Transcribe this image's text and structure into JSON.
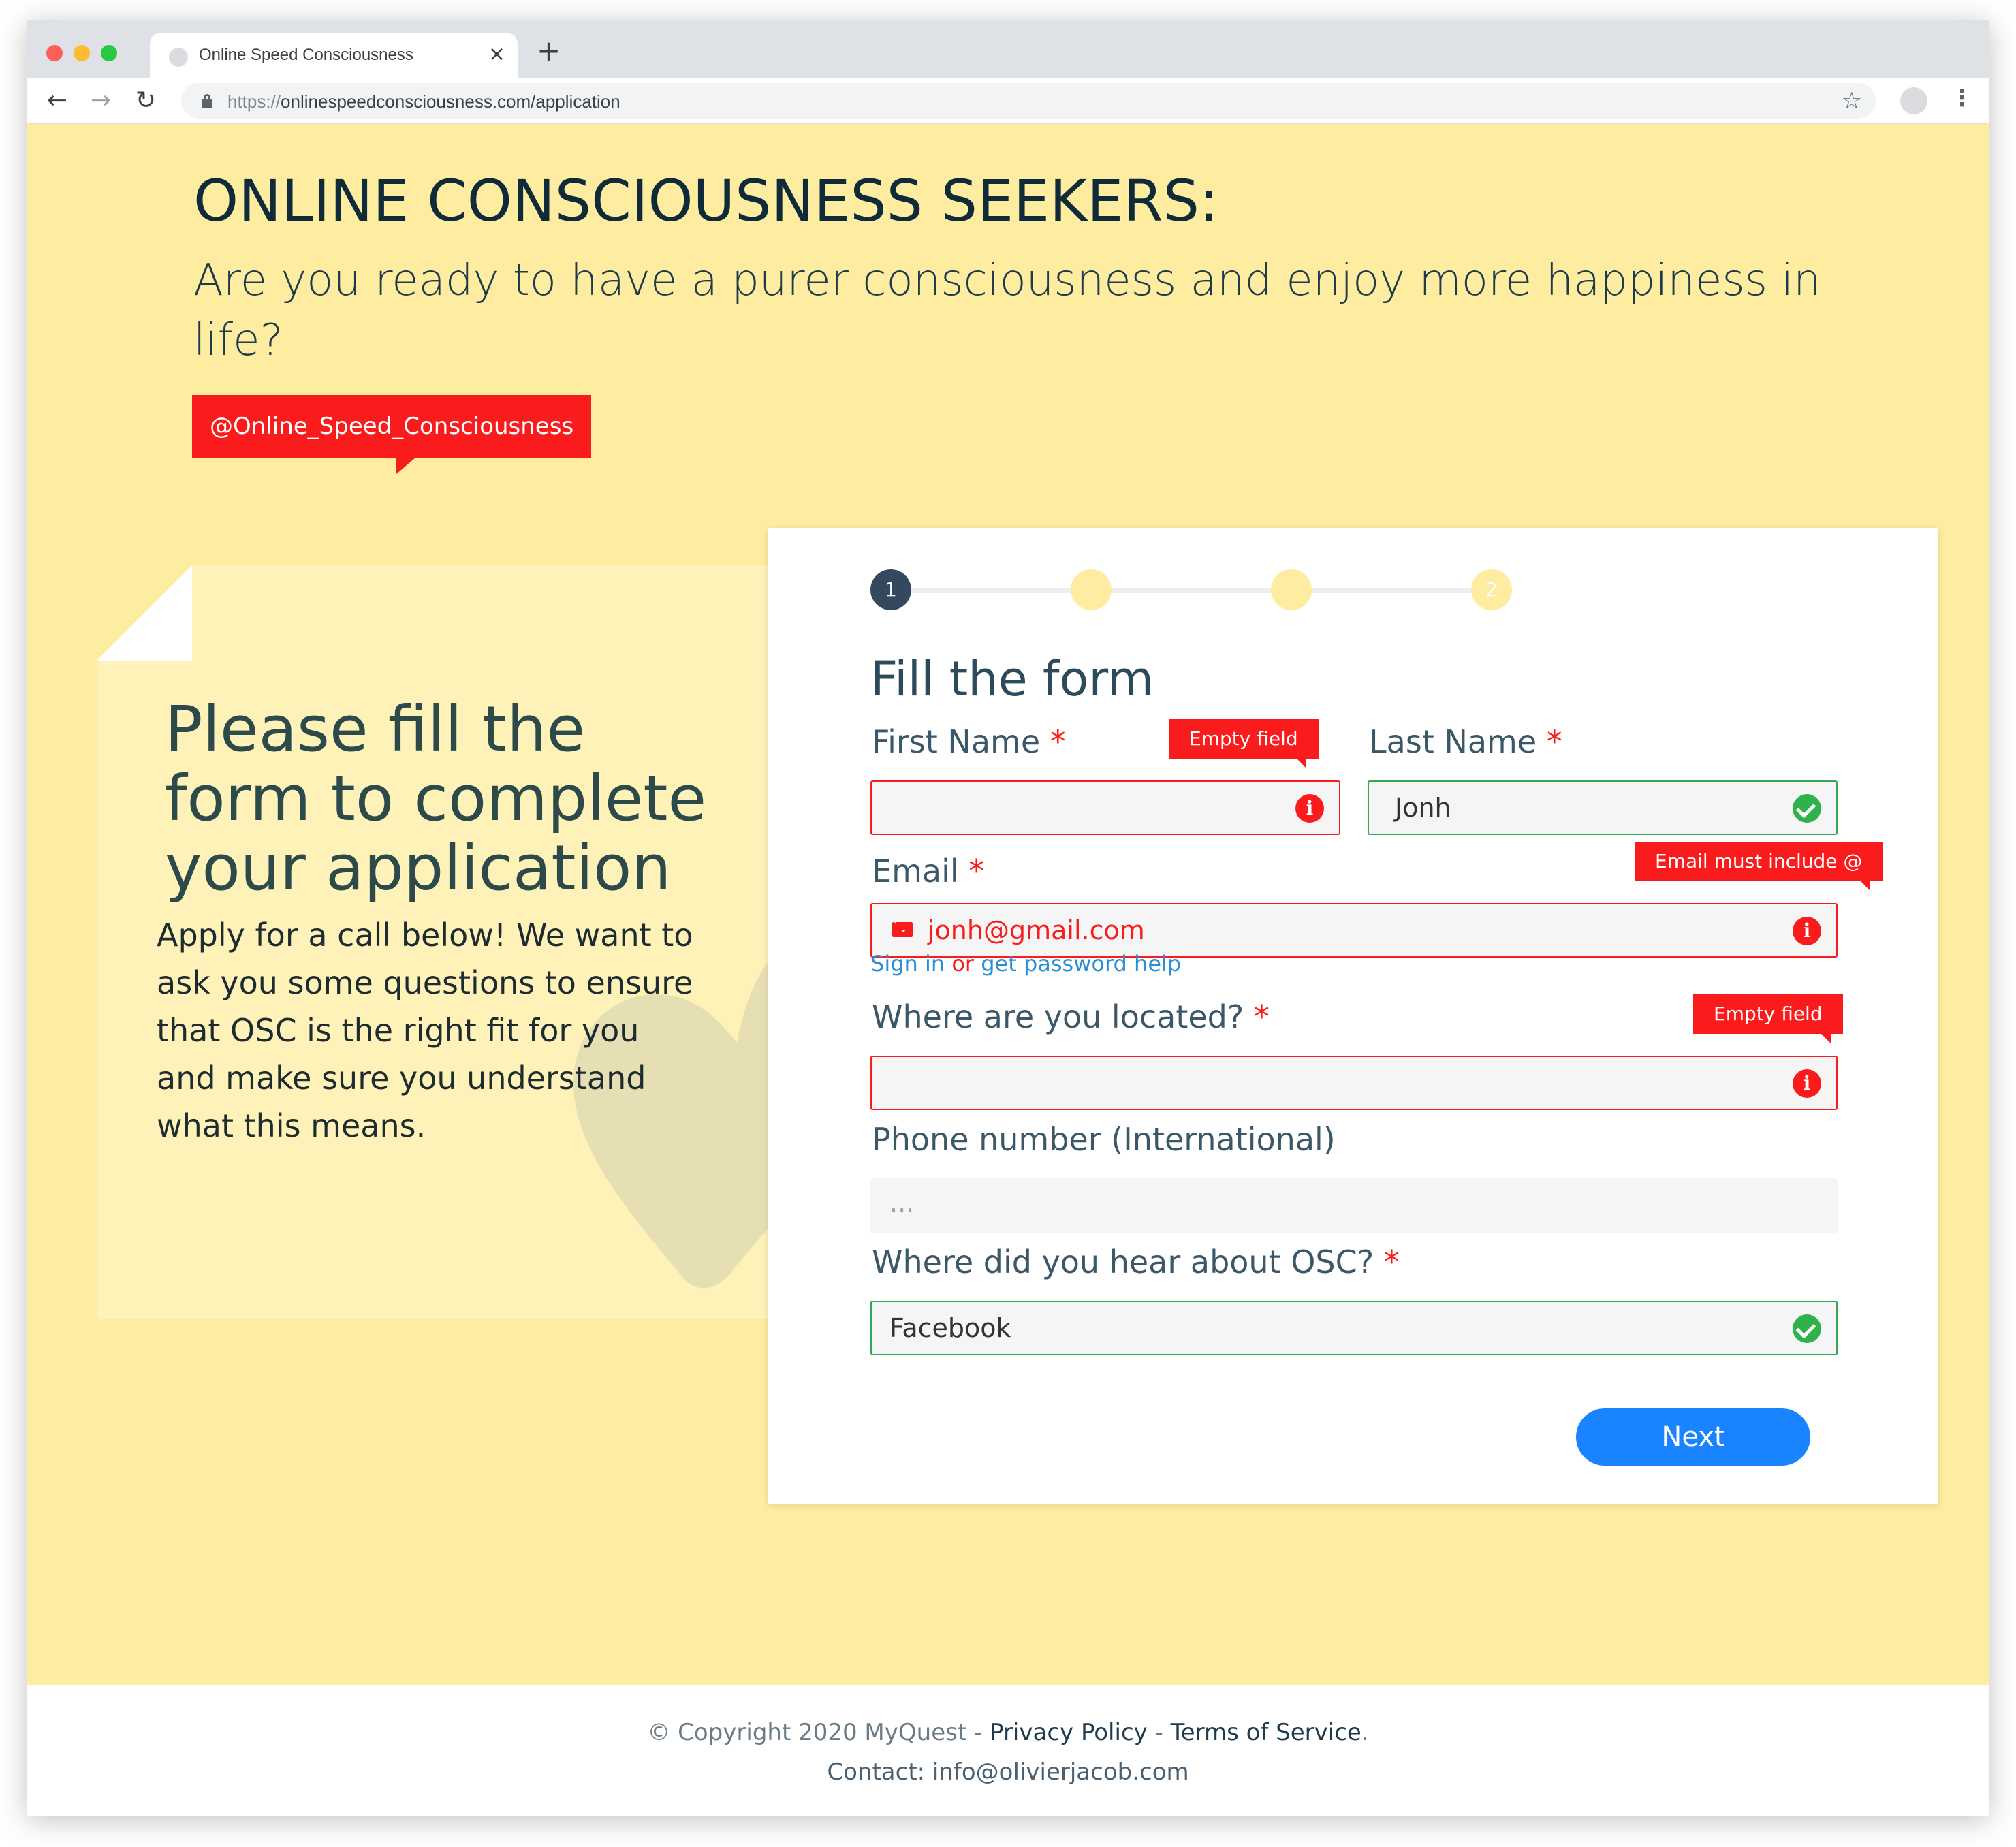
{
  "browser": {
    "tab_title": "Online Speed Consciousness",
    "tab_close": "×",
    "new_tab": "+",
    "url_protocol": "https://",
    "url_rest": "onlinespeedconsciousness.com/application",
    "back": "←",
    "forward": "→",
    "reload": "↻",
    "star": "☆",
    "menu": "⋮"
  },
  "hero": {
    "headline": "ONLINE CONSCIOUSNESS SEEKERS:",
    "subhead": "Are you ready to have a purer consciousness and enjoy more happiness in life?",
    "handle": "@Online_Speed_Consciousness"
  },
  "note": {
    "title": "Please fill the form to complete your application",
    "body": "Apply for a call below! We want to ask you some questions to ensure that OSC is the right fit for you and make sure you understand what this means."
  },
  "form": {
    "steps": [
      "1",
      "",
      "",
      "2"
    ],
    "title": "Fill the form",
    "required_mark": "*",
    "first_name": {
      "label": "First Name",
      "value": "",
      "error": "Empty field"
    },
    "last_name": {
      "label": "Last Name",
      "value": "Jonh"
    },
    "email": {
      "label": "Email",
      "value": "jonh@gmail.com",
      "error": "Email must include @"
    },
    "help": {
      "sign_in": "Sign in",
      "or": " or ",
      "password": "get password help"
    },
    "location": {
      "label": "Where are you located?",
      "value": "",
      "error": "Empty field"
    },
    "phone": {
      "label": "Phone number (International)",
      "placeholder": "..."
    },
    "source": {
      "label": "Where did you hear about OSC?",
      "value": "Facebook"
    },
    "next": "Next"
  },
  "footer": {
    "copyright": "© Copyright 2020 MyQuest - ",
    "privacy": "Privacy Policy",
    "sep": " - ",
    "terms": "Terms of Service",
    "dot": ".",
    "contact": "Contact: info@olivierjacob.com"
  },
  "colors": {
    "page_bg": "#feeca0",
    "accent_red": "#fa1c1c",
    "button_blue": "#1a83ff",
    "success_green": "#2fb24c",
    "step_active": "#34495e"
  },
  "icons": [
    "lock-icon",
    "star-icon",
    "info-icon",
    "check-icon",
    "mail-icon",
    "heart-icon"
  ]
}
